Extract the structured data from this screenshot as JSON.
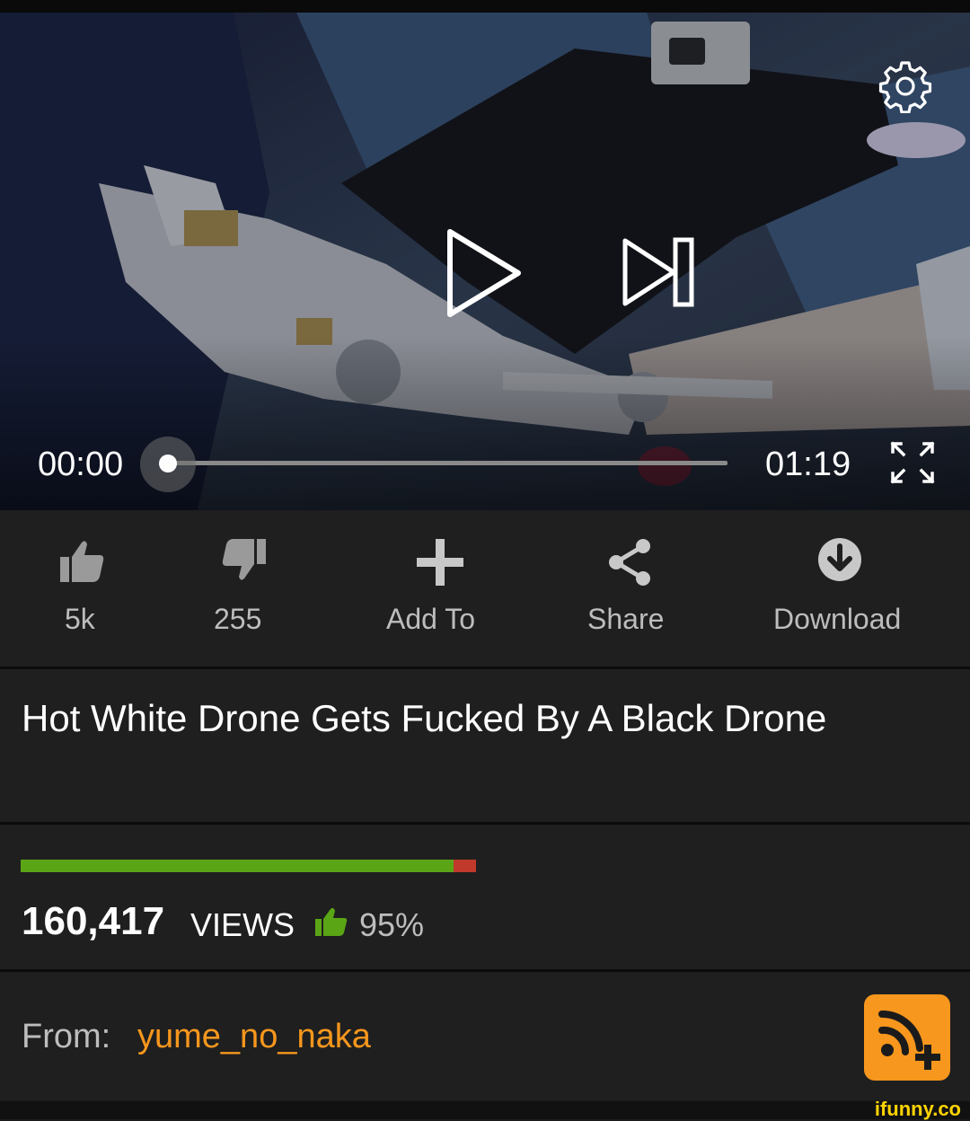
{
  "player": {
    "current_time": "00:00",
    "duration": "01:19",
    "progress_fraction": 0.0
  },
  "actions": {
    "like_count": "5k",
    "dislike_count": "255",
    "add_to_label": "Add To",
    "share_label": "Share",
    "download_label": "Download"
  },
  "video": {
    "title": "Hot White Drone Gets Fucked By A Black Drone",
    "views_count": "160,417",
    "views_label": "VIEWS",
    "rating_percent": "95%",
    "rating_fraction": 0.95
  },
  "uploader": {
    "from_label": "From:",
    "username": "yume_no_naka"
  },
  "watermark": "ifunny.co",
  "colors": {
    "accent_orange": "#f7971d",
    "rating_green": "#5aa516",
    "rating_red": "#c0392b",
    "background": "#1f1f1f"
  },
  "icons": {
    "settings": "gear-icon",
    "play": "play-icon",
    "next": "skip-next-icon",
    "fullscreen": "fullscreen-icon",
    "like": "thumbs-up-icon",
    "dislike": "thumbs-down-icon",
    "add": "plus-icon",
    "share": "share-icon",
    "download": "download-icon",
    "subscribe": "rss-subscribe-icon"
  }
}
